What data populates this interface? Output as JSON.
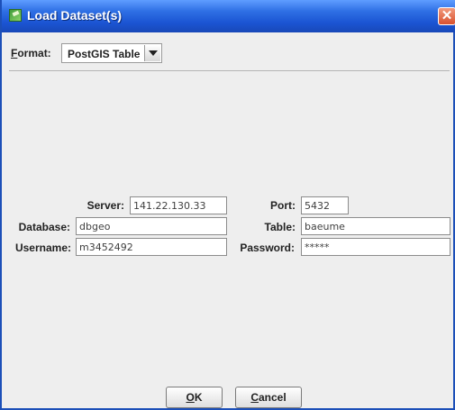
{
  "window": {
    "title": "Load Dataset(s)",
    "close_glyph": "✕",
    "icon": "app-icon",
    "titlebar_color": "#2e6fe4",
    "close_color": "#d8512f"
  },
  "format": {
    "mnemonic": "F",
    "label_rest": "ormat:",
    "selected": "PostGIS Table"
  },
  "connection": {
    "server_label": "Server:",
    "server_value": "141.22.130.33",
    "port_label": "Port:",
    "port_value": "5432",
    "database_label": "Database:",
    "database_value": "dbgeo",
    "table_label": "Table:",
    "table_value": "baeume",
    "username_label": "Username:",
    "username_value": "m3452492",
    "password_label": "Password:",
    "password_value": "*****"
  },
  "buttons": {
    "ok_mnemonic": "O",
    "ok_rest": "K",
    "cancel_mnemonic": "C",
    "cancel_rest": "ancel"
  }
}
